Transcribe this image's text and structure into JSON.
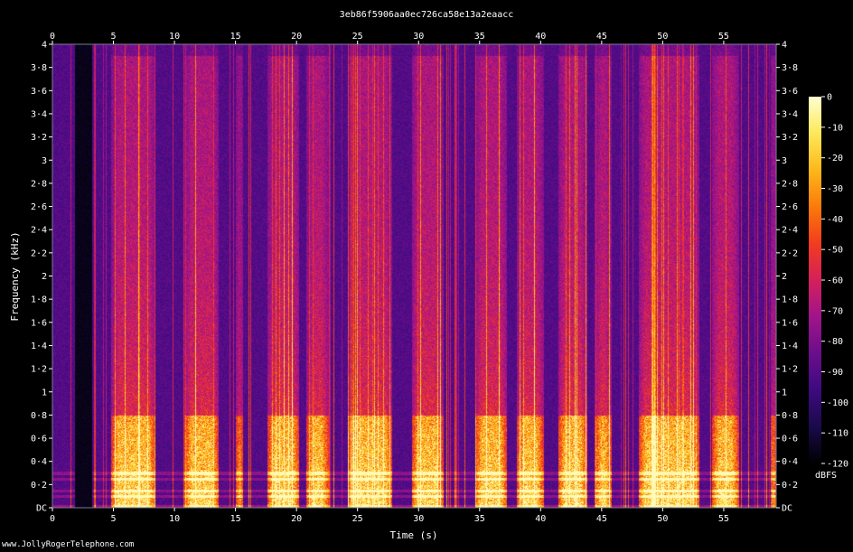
{
  "chart_data": {
    "type": "heatmap",
    "title": "3eb86f5906aa0ec726ca58e13a2eaacc",
    "xlabel": "Time (s)",
    "ylabel": "Frequency (kHz)",
    "xlim": [
      0,
      59.3
    ],
    "ylim": [
      0,
      4
    ],
    "x_ticks": [
      {
        "value": 0,
        "label": "0"
      },
      {
        "value": 5,
        "label": "5"
      },
      {
        "value": 10,
        "label": "10"
      },
      {
        "value": 15,
        "label": "15"
      },
      {
        "value": 20,
        "label": "20"
      },
      {
        "value": 25,
        "label": "25"
      },
      {
        "value": 30,
        "label": "30"
      },
      {
        "value": 35,
        "label": "35"
      },
      {
        "value": 40,
        "label": "40"
      },
      {
        "value": 45,
        "label": "45"
      },
      {
        "value": 50,
        "label": "50"
      },
      {
        "value": 55,
        "label": "55"
      }
    ],
    "y_ticks": [
      {
        "value": 0,
        "label": "DC"
      },
      {
        "value": 0.2,
        "label": "0·2"
      },
      {
        "value": 0.4,
        "label": "0·4"
      },
      {
        "value": 0.6,
        "label": "0·6"
      },
      {
        "value": 0.8,
        "label": "0·8"
      },
      {
        "value": 1.0,
        "label": "1"
      },
      {
        "value": 1.2,
        "label": "1·2"
      },
      {
        "value": 1.4,
        "label": "1·4"
      },
      {
        "value": 1.6,
        "label": "1·6"
      },
      {
        "value": 1.8,
        "label": "1·8"
      },
      {
        "value": 2.0,
        "label": "2"
      },
      {
        "value": 2.2,
        "label": "2·2"
      },
      {
        "value": 2.4,
        "label": "2·4"
      },
      {
        "value": 2.6,
        "label": "2·6"
      },
      {
        "value": 2.8,
        "label": "2·8"
      },
      {
        "value": 3.0,
        "label": "3"
      },
      {
        "value": 3.2,
        "label": "3·2"
      },
      {
        "value": 3.4,
        "label": "3·4"
      },
      {
        "value": 3.6,
        "label": "3·6"
      },
      {
        "value": 3.8,
        "label": "3·8"
      },
      {
        "value": 4.0,
        "label": "4"
      }
    ],
    "colorbar": {
      "unit": "dBFS",
      "range": [
        -120,
        0
      ],
      "ticks": [
        {
          "value": 0,
          "label": "0"
        },
        {
          "value": -10,
          "label": "-10"
        },
        {
          "value": -20,
          "label": "-20"
        },
        {
          "value": -30,
          "label": "-30"
        },
        {
          "value": -40,
          "label": "-40"
        },
        {
          "value": -50,
          "label": "-50"
        },
        {
          "value": -60,
          "label": "-60"
        },
        {
          "value": -70,
          "label": "-70"
        },
        {
          "value": -80,
          "label": "-80"
        },
        {
          "value": -90,
          "label": "-90"
        },
        {
          "value": -100,
          "label": "-100"
        },
        {
          "value": -110,
          "label": "-110"
        },
        {
          "value": -120,
          "label": "-120"
        }
      ],
      "colormap": [
        "#000000",
        "#1a0a4a",
        "#3d0a80",
        "#6a0e8a",
        "#a0148a",
        "#d4205a",
        "#f23c1e",
        "#fb7a0a",
        "#fdb81a",
        "#fde85a",
        "#ffffd0"
      ]
    },
    "silence_gap_s": [
      1.8,
      3.2
    ],
    "speech_bursts_s": [
      [
        4.8,
        8.4
      ],
      [
        10.8,
        13.6
      ],
      [
        15.0,
        15.6
      ],
      [
        17.6,
        20.2
      ],
      [
        20.8,
        22.6
      ],
      [
        24.2,
        27.8
      ],
      [
        29.4,
        32.0
      ],
      [
        34.6,
        37.2
      ],
      [
        38.0,
        40.2
      ],
      [
        41.4,
        43.8
      ],
      [
        44.4,
        45.8
      ],
      [
        48.0,
        53.0
      ],
      [
        54.0,
        56.2
      ],
      [
        58.8,
        59.3
      ]
    ],
    "harmonic_lines_khz": [
      0.1,
      0.15,
      0.25,
      0.3
    ]
  },
  "footer": "www.JollyRogerTelephone.com"
}
